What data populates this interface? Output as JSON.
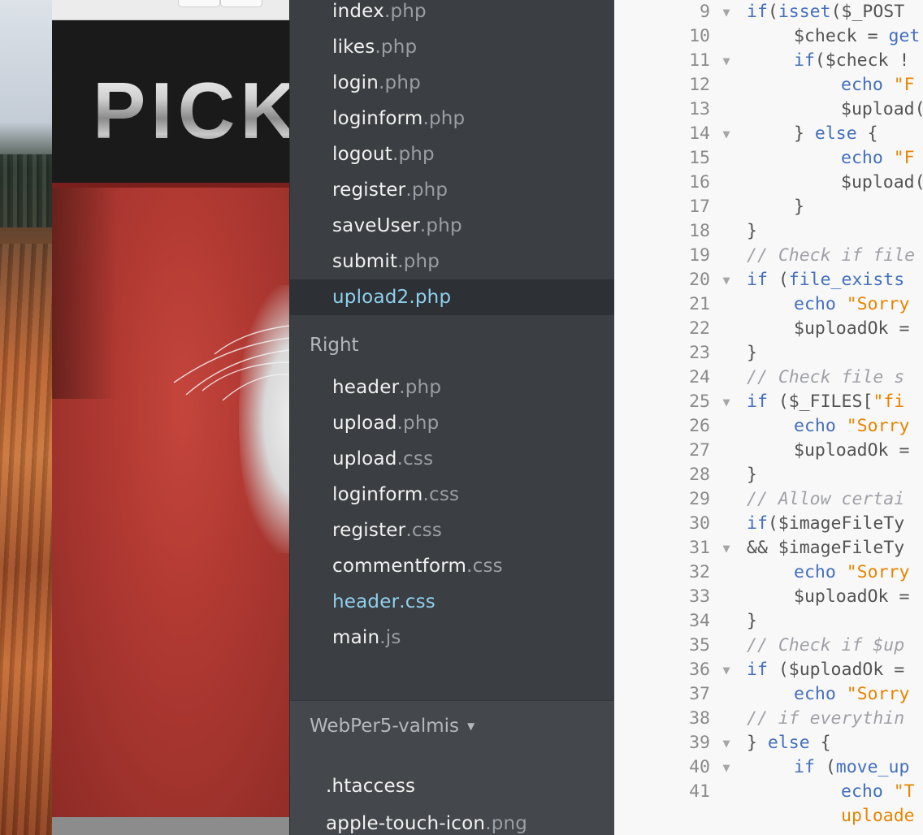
{
  "browser": {
    "site_logo": "PICK"
  },
  "sidebar": {
    "left_files": [
      {
        "name": "index",
        "ext": ".php",
        "state": "normal"
      },
      {
        "name": "likes",
        "ext": ".php",
        "state": "normal"
      },
      {
        "name": "login",
        "ext": ".php",
        "state": "normal"
      },
      {
        "name": "loginform",
        "ext": ".php",
        "state": "normal"
      },
      {
        "name": "logout",
        "ext": ".php",
        "state": "normal"
      },
      {
        "name": "register",
        "ext": ".php",
        "state": "normal"
      },
      {
        "name": "saveUser",
        "ext": ".php",
        "state": "normal"
      },
      {
        "name": "submit",
        "ext": ".php",
        "state": "normal"
      },
      {
        "name": "upload2",
        "ext": ".php",
        "state": "selected"
      }
    ],
    "right_group_title": "Right",
    "right_files": [
      {
        "name": "header",
        "ext": ".php",
        "state": "normal"
      },
      {
        "name": "upload",
        "ext": ".php",
        "state": "normal"
      },
      {
        "name": "upload",
        "ext": ".css",
        "state": "normal"
      },
      {
        "name": "loginform",
        "ext": ".css",
        "state": "normal"
      },
      {
        "name": "register",
        "ext": ".css",
        "state": "normal"
      },
      {
        "name": "commentform",
        "ext": ".css",
        "state": "normal"
      },
      {
        "name": "header",
        "ext": ".css",
        "state": "modified"
      },
      {
        "name": "main",
        "ext": ".js",
        "state": "normal"
      }
    ],
    "project": {
      "title": "WebPer5-valmis",
      "caret_icon": "triangle-down-icon",
      "files": [
        {
          "name": ".htaccess",
          "ext": ""
        },
        {
          "name": "apple-touch-icon",
          "ext": ".png"
        }
      ]
    }
  },
  "editor": {
    "lines": [
      {
        "n": "9",
        "fold": true,
        "indent": 0,
        "tokens": [
          [
            "kw",
            "if"
          ],
          [
            "plain",
            "("
          ],
          [
            "fn",
            "isset"
          ],
          [
            "plain",
            "($_POST"
          ]
        ]
      },
      {
        "n": "10",
        "fold": false,
        "indent": 1,
        "tokens": [
          [
            "var",
            "$check"
          ],
          [
            "plain",
            " = "
          ],
          [
            "fn",
            "get"
          ]
        ]
      },
      {
        "n": "11",
        "fold": true,
        "indent": 1,
        "tokens": [
          [
            "kw",
            "if"
          ],
          [
            "plain",
            "($check !"
          ]
        ]
      },
      {
        "n": "12",
        "fold": false,
        "indent": 2,
        "tokens": [
          [
            "kw",
            "echo"
          ],
          [
            "plain",
            " "
          ],
          [
            "str",
            "\"F"
          ]
        ]
      },
      {
        "n": "13",
        "fold": false,
        "indent": 2,
        "tokens": [
          [
            "var",
            "$upload("
          ]
        ]
      },
      {
        "n": "14",
        "fold": true,
        "indent": 1,
        "tokens": [
          [
            "plain",
            "} "
          ],
          [
            "kw",
            "else"
          ],
          [
            "plain",
            " {"
          ]
        ]
      },
      {
        "n": "15",
        "fold": false,
        "indent": 2,
        "tokens": [
          [
            "kw",
            "echo"
          ],
          [
            "plain",
            " "
          ],
          [
            "str",
            "\"F"
          ]
        ]
      },
      {
        "n": "16",
        "fold": false,
        "indent": 2,
        "tokens": [
          [
            "var",
            "$upload("
          ]
        ]
      },
      {
        "n": "17",
        "fold": false,
        "indent": 1,
        "tokens": [
          [
            "plain",
            "}"
          ]
        ]
      },
      {
        "n": "18",
        "fold": false,
        "indent": 0,
        "tokens": [
          [
            "plain",
            "}"
          ]
        ]
      },
      {
        "n": "19",
        "fold": false,
        "indent": 0,
        "tokens": [
          [
            "com",
            "// Check if file"
          ]
        ]
      },
      {
        "n": "20",
        "fold": true,
        "indent": 0,
        "tokens": [
          [
            "kw",
            "if"
          ],
          [
            "plain",
            " ("
          ],
          [
            "fn",
            "file_exists"
          ]
        ]
      },
      {
        "n": "21",
        "fold": false,
        "indent": 1,
        "tokens": [
          [
            "kw",
            "echo"
          ],
          [
            "plain",
            " "
          ],
          [
            "str",
            "\"Sorry"
          ]
        ]
      },
      {
        "n": "22",
        "fold": false,
        "indent": 1,
        "tokens": [
          [
            "var",
            "$uploadOk"
          ],
          [
            "plain",
            " ="
          ]
        ]
      },
      {
        "n": "23",
        "fold": false,
        "indent": 0,
        "tokens": [
          [
            "plain",
            "}"
          ]
        ]
      },
      {
        "n": "24",
        "fold": false,
        "indent": 0,
        "tokens": [
          [
            "com",
            "// Check file s"
          ]
        ]
      },
      {
        "n": "25",
        "fold": true,
        "indent": 0,
        "tokens": [
          [
            "kw",
            "if"
          ],
          [
            "plain",
            " ($_FILES["
          ],
          [
            "str",
            "\"fi"
          ]
        ]
      },
      {
        "n": "26",
        "fold": false,
        "indent": 1,
        "tokens": [
          [
            "kw",
            "echo"
          ],
          [
            "plain",
            " "
          ],
          [
            "str",
            "\"Sorry"
          ]
        ]
      },
      {
        "n": "27",
        "fold": false,
        "indent": 1,
        "tokens": [
          [
            "var",
            "$uploadOk"
          ],
          [
            "plain",
            " ="
          ]
        ]
      },
      {
        "n": "28",
        "fold": false,
        "indent": 0,
        "tokens": [
          [
            "plain",
            "}"
          ]
        ]
      },
      {
        "n": "29",
        "fold": false,
        "indent": 0,
        "tokens": [
          [
            "com",
            "// Allow certai"
          ]
        ]
      },
      {
        "n": "30",
        "fold": false,
        "indent": 0,
        "tokens": [
          [
            "kw",
            "if"
          ],
          [
            "plain",
            "($imageFileTy"
          ]
        ]
      },
      {
        "n": "31",
        "fold": true,
        "indent": 0,
        "tokens": [
          [
            "plain",
            "&& $imageFileTy"
          ]
        ]
      },
      {
        "n": "32",
        "fold": false,
        "indent": 1,
        "tokens": [
          [
            "kw",
            "echo"
          ],
          [
            "plain",
            " "
          ],
          [
            "str",
            "\"Sorry"
          ]
        ]
      },
      {
        "n": "33",
        "fold": false,
        "indent": 1,
        "tokens": [
          [
            "var",
            "$uploadOk"
          ],
          [
            "plain",
            " ="
          ]
        ]
      },
      {
        "n": "34",
        "fold": false,
        "indent": 0,
        "tokens": [
          [
            "plain",
            "}"
          ]
        ]
      },
      {
        "n": "35",
        "fold": false,
        "indent": 0,
        "tokens": [
          [
            "com",
            "// Check if $up"
          ]
        ]
      },
      {
        "n": "36",
        "fold": true,
        "indent": 0,
        "tokens": [
          [
            "kw",
            "if"
          ],
          [
            "plain",
            " ($uploadOk ="
          ]
        ]
      },
      {
        "n": "37",
        "fold": false,
        "indent": 1,
        "tokens": [
          [
            "kw",
            "echo"
          ],
          [
            "plain",
            " "
          ],
          [
            "str",
            "\"Sorry"
          ]
        ]
      },
      {
        "n": "38",
        "fold": false,
        "indent": 0,
        "tokens": [
          [
            "com",
            "// if everythin"
          ]
        ]
      },
      {
        "n": "39",
        "fold": true,
        "indent": 0,
        "tokens": [
          [
            "plain",
            "} "
          ],
          [
            "kw",
            "else"
          ],
          [
            "plain",
            " {"
          ]
        ]
      },
      {
        "n": "40",
        "fold": true,
        "indent": 1,
        "tokens": [
          [
            "kw",
            "if"
          ],
          [
            "plain",
            " ("
          ],
          [
            "fn",
            "move_up"
          ]
        ]
      },
      {
        "n": "41",
        "fold": false,
        "indent": 2,
        "tokens": [
          [
            "kw",
            "echo"
          ],
          [
            "plain",
            " "
          ],
          [
            "str",
            "\"T"
          ]
        ]
      },
      {
        "n": "",
        "fold": false,
        "indent": 2,
        "tokens": [
          [
            "str",
            "uploade"
          ]
        ]
      }
    ],
    "fold_glyph": "▼"
  }
}
